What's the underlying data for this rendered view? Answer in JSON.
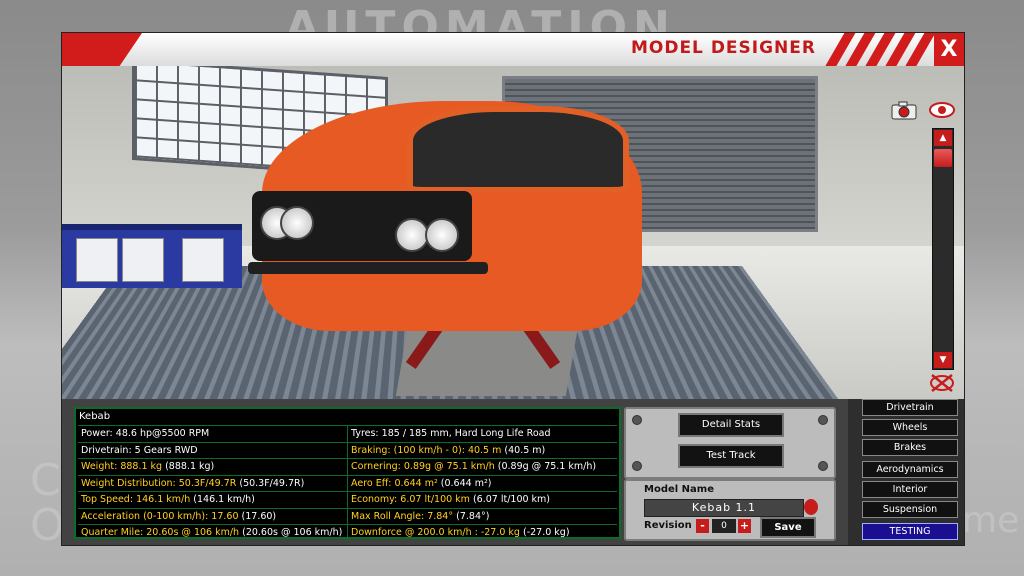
{
  "background": {
    "logo_text": "AUTOMATION",
    "left_fragment_1": "C",
    "left_fragment_2": "O",
    "right_fragment": "me"
  },
  "window": {
    "title": "MODEL DESIGNER",
    "close_label": "X",
    "accent_color": "#d21c1c"
  },
  "viewport_icons": [
    "camera-icon",
    "eye-icon",
    "reset-view-icon"
  ],
  "stats": {
    "car_name": "Kebab",
    "rows": [
      {
        "left": {
          "label": "Power: ",
          "value": "48.6 hp@5500 RPM",
          "color": "white"
        },
        "right": {
          "label": "Tyres: ",
          "value": "185 / 185 mm, Hard Long Life Road",
          "color": "white"
        }
      },
      {
        "left": {
          "label": "Drivetrain: ",
          "value": "5 Gears RWD",
          "color": "white"
        },
        "right": {
          "label": "Braking: ",
          "value": "(100 km/h - 0): 40.5 m",
          "paren": " (40.5 m)",
          "color": "yellow"
        }
      },
      {
        "left": {
          "label": "Weight: ",
          "value": "888.1 kg",
          "paren": " (888.1 kg)",
          "color": "yellow"
        },
        "right": {
          "label": "Cornering: ",
          "value": "0.89g @ 75.1 km/h",
          "paren": " (0.89g @ 75.1 km/h)",
          "color": "yellow"
        }
      },
      {
        "left": {
          "label": "Weight Distribution: ",
          "value": "50.3F/49.7R",
          "paren": " (50.3F/49.7R)",
          "color": "yellow"
        },
        "right": {
          "label": "Aero Eff: ",
          "value": "0.644 m²",
          "paren": " (0.644 m²)",
          "color": "yellow"
        }
      },
      {
        "left": {
          "label": "Top Speed: ",
          "value": "146.1 km/h",
          "paren": " (146.1 km/h)",
          "color": "yellow"
        },
        "right": {
          "label": "Economy: ",
          "value": "6.07 lt/100 km",
          "paren": " (6.07 lt/100 km)",
          "color": "yellow"
        }
      },
      {
        "left": {
          "label": "Acceleration ",
          "value": "(0-100 km/h): 17.60",
          "paren": " (17.60)",
          "color": "yellow"
        },
        "right": {
          "label": "Max Roll Angle: ",
          "value": "7.84°",
          "paren": " (7.84°)",
          "color": "yellow"
        }
      },
      {
        "left": {
          "label": "Quarter Mile: ",
          "value": "20.60s @ 106 km/h",
          "paren": " (20.60s @ 106 km/h)",
          "color": "yellow"
        },
        "right": {
          "label": "Downforce @ ",
          "value": "200.0 km/h : -27.0 kg",
          "paren": " (-27.0 kg)",
          "color": "yellow"
        }
      }
    ]
  },
  "actions": {
    "detail_stats": "Detail Stats",
    "test_track": "Test Track"
  },
  "model": {
    "name_label": "Model Name",
    "name_value": "Kebab 1.1",
    "revision_label": "Revision",
    "revision_value": "0",
    "minus": "-",
    "plus": "+",
    "save": "Save"
  },
  "nav": {
    "items": [
      "Drivetrain",
      "Wheels",
      "Brakes",
      "Aerodynamics",
      "Interior",
      "Suspension",
      "TESTING"
    ],
    "active_index": 6
  }
}
